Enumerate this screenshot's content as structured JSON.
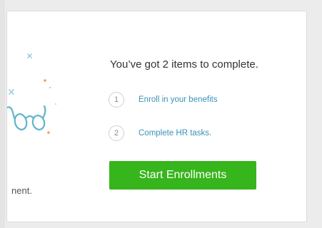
{
  "illustration": {
    "icon": "glasses-icon"
  },
  "left_panel": {
    "cut_text": "nent."
  },
  "main": {
    "heading": "You’ve got 2 items to complete.",
    "tasks": [
      {
        "number": "1",
        "label": "Enroll in your benefits"
      },
      {
        "number": "2",
        "label": "Complete HR tasks."
      }
    ],
    "cta_label": "Start Enrollments"
  },
  "colors": {
    "accent_green": "#37b51c",
    "link_blue": "#3a92b9",
    "glasses_teal": "#5fb5c8"
  }
}
